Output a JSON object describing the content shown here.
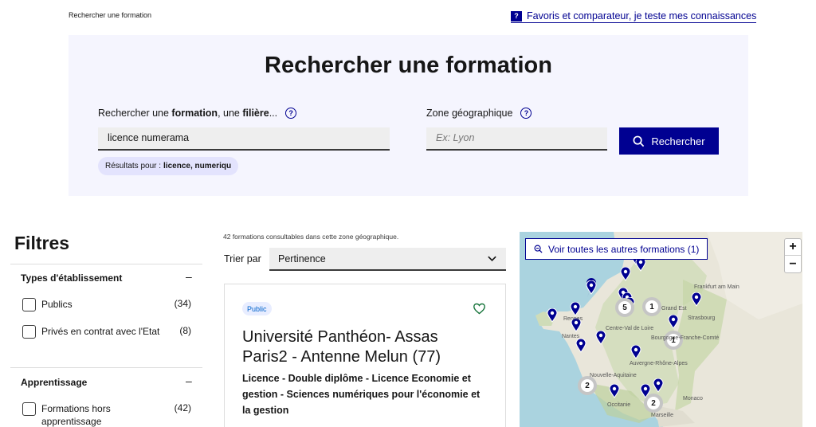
{
  "breadcrumb": "Rechercher une formation",
  "help_link": "Favoris et comparateur, je teste mes connaissances",
  "search": {
    "title": "Rechercher une formation",
    "label_part1": "Rechercher une ",
    "label_bold1": "formation",
    "label_part2": ", une ",
    "label_bold2": "filière",
    "label_part3": "...",
    "value": "licence numerama",
    "zone_label": "Zone géographique",
    "zone_placeholder": "Ex: Lyon",
    "button": "Rechercher",
    "results_prefix": "Résultats pour :",
    "results_terms": "licence, numeriqu"
  },
  "filters": {
    "title": "Filtres",
    "groups": [
      {
        "title": "Types d'établissement",
        "items": [
          {
            "label": "Publics",
            "count": "(34)"
          },
          {
            "label": "Privés en contrat avec l'Etat",
            "count": "(8)"
          }
        ]
      },
      {
        "title": "Apprentissage",
        "items": [
          {
            "label": "Formations hors apprentissage",
            "count": "(42)"
          }
        ]
      }
    ]
  },
  "results": {
    "count_text": "42 formations consultables dans cette zone géographique.",
    "sort_label": "Trier par",
    "sort_value": "Pertinence",
    "cards": [
      {
        "badge": "Public",
        "title": "Université Panthéon- Assas Paris2 - Antenne Melun (77)",
        "subtitle": "Licence - Double diplôme - Licence Economie et gestion - Sciences numériques pour l'économie et la gestion"
      }
    ]
  },
  "map": {
    "button": "Voir toutes les autres formations (1)",
    "zoom_in": "+",
    "zoom_out": "−",
    "places": [
      "Frankfurt am Main",
      "Strasbourg",
      "Rennes",
      "Nantes",
      "Monaco",
      "Marseille",
      "Grand Est",
      "Centre-Val de Loire",
      "Bourgogne-Franche-Comté",
      "Auvergne-Rhône-Alpes",
      "Nouvelle-Aquitaine",
      "Occitanie"
    ],
    "clusters": [
      "1",
      "2",
      "2",
      "1",
      "5"
    ]
  },
  "colors": {
    "primary": "#000091",
    "panel_bg": "#f5f5fe",
    "badge_text": "#0063cb",
    "heart": "#18753c"
  }
}
